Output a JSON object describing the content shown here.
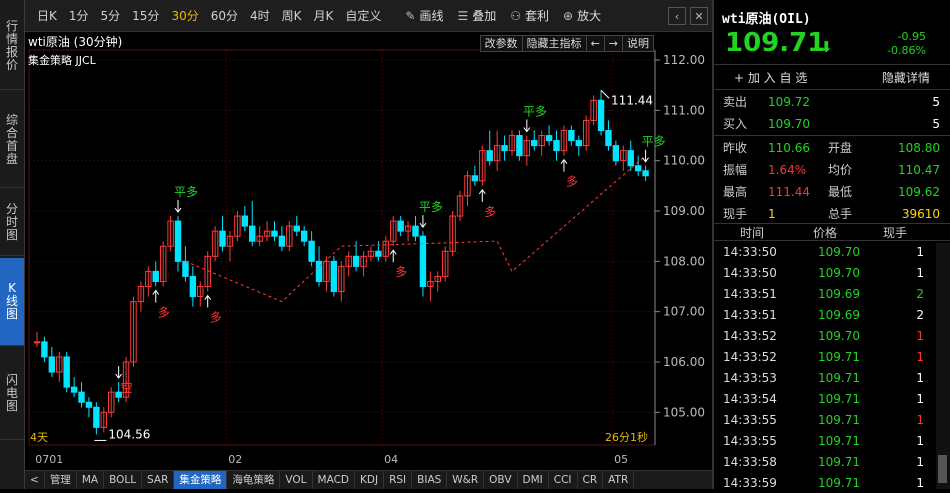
{
  "sidebar": [
    {
      "label": "行情报价",
      "active": false
    },
    {
      "label": "综合首盘",
      "active": false
    },
    {
      "label": "分时图",
      "active": false
    },
    {
      "label": "K线图",
      "active": true
    },
    {
      "label": "闪电图",
      "active": false
    }
  ],
  "toolbar": {
    "periods": [
      "日K",
      "1分",
      "5分",
      "15分",
      "30分",
      "60分",
      "4时",
      "周K",
      "月K",
      "自定义"
    ],
    "active_period": "30分",
    "tools": [
      {
        "icon": "pencil-icon",
        "glyph": "✎",
        "label": "画线"
      },
      {
        "icon": "stack-icon",
        "glyph": "☰",
        "label": "叠加"
      },
      {
        "icon": "arbitrage-icon",
        "glyph": "⚇",
        "label": "套利"
      },
      {
        "icon": "zoom-in-icon",
        "glyph": "⊕",
        "label": "放大"
      }
    ],
    "nav_prev": "‹",
    "nav_close": "✕"
  },
  "chart": {
    "title": "wti原油 (30分钟)",
    "strategy_label": "集金策略 JJCL",
    "buttons": [
      "改参数",
      "隐藏主指标",
      "←",
      "→",
      "说明"
    ],
    "bottom_left": "4天",
    "bottom_right": "26分1秒",
    "max_label": "111.44",
    "min_label": "104.56",
    "signals": {
      "long": "多",
      "flat": "平多",
      "short": "空"
    },
    "scroll_left": "<"
  },
  "chart_data": {
    "type": "candlestick",
    "y_ticks": [
      112.0,
      111.0,
      110.0,
      109.0,
      108.0,
      107.0,
      106.0,
      105.0
    ],
    "ylim": [
      104.35,
      112.2
    ],
    "x_ticks": [
      "0701",
      "02",
      "04",
      "05"
    ],
    "signals": [
      {
        "type": "short",
        "index": 11
      },
      {
        "type": "long",
        "index": 16
      },
      {
        "type": "flat",
        "index": 19
      },
      {
        "type": "long",
        "index": 23
      },
      {
        "type": "long",
        "index": 48
      },
      {
        "type": "flat",
        "index": 52
      },
      {
        "type": "long",
        "index": 60
      },
      {
        "type": "flat",
        "index": 66
      },
      {
        "type": "long",
        "index": 71
      },
      {
        "type": "flat",
        "index": 101
      }
    ],
    "candles": [
      [
        106.4,
        106.6,
        106.3,
        106.4
      ],
      [
        106.4,
        106.5,
        106.0,
        106.1
      ],
      [
        106.1,
        106.3,
        105.7,
        105.8
      ],
      [
        105.8,
        106.2,
        105.6,
        106.1
      ],
      [
        106.1,
        106.2,
        105.4,
        105.5
      ],
      [
        105.5,
        105.7,
        105.3,
        105.4
      ],
      [
        105.4,
        105.6,
        105.1,
        105.2
      ],
      [
        105.2,
        105.3,
        104.9,
        105.1
      ],
      [
        105.1,
        105.2,
        104.56,
        104.7
      ],
      [
        104.7,
        105.1,
        104.6,
        105.0
      ],
      [
        105.0,
        105.5,
        104.9,
        105.4
      ],
      [
        105.4,
        105.6,
        105.2,
        105.3
      ],
      [
        105.3,
        106.1,
        105.2,
        106.0
      ],
      [
        106.0,
        107.3,
        105.9,
        107.2
      ],
      [
        107.2,
        107.6,
        107.0,
        107.5
      ],
      [
        107.5,
        107.9,
        107.3,
        107.8
      ],
      [
        107.8,
        108.0,
        107.5,
        107.6
      ],
      [
        107.6,
        108.4,
        107.5,
        108.3
      ],
      [
        108.3,
        108.9,
        108.2,
        108.8
      ],
      [
        108.8,
        108.9,
        107.8,
        108.0
      ],
      [
        108.0,
        108.3,
        107.6,
        107.7
      ],
      [
        107.7,
        107.9,
        107.1,
        107.3
      ],
      [
        107.3,
        107.6,
        107.1,
        107.5
      ],
      [
        107.5,
        108.2,
        107.4,
        108.1
      ],
      [
        108.1,
        108.7,
        108.0,
        108.6
      ],
      [
        108.6,
        108.9,
        108.2,
        108.3
      ],
      [
        108.3,
        108.6,
        108.0,
        108.5
      ],
      [
        108.5,
        109.0,
        108.4,
        108.9
      ],
      [
        108.9,
        109.1,
        108.6,
        108.7
      ],
      [
        108.7,
        109.2,
        108.3,
        108.4
      ],
      [
        108.4,
        108.7,
        108.3,
        108.5
      ],
      [
        108.5,
        108.8,
        108.4,
        108.6
      ],
      [
        108.6,
        108.8,
        108.4,
        108.5
      ],
      [
        108.5,
        108.7,
        108.2,
        108.3
      ],
      [
        108.3,
        108.8,
        108.2,
        108.7
      ],
      [
        108.7,
        108.9,
        108.5,
        108.6
      ],
      [
        108.6,
        108.7,
        108.3,
        108.4
      ],
      [
        108.4,
        108.6,
        107.9,
        108.0
      ],
      [
        108.0,
        108.3,
        107.5,
        107.6
      ],
      [
        107.6,
        108.1,
        107.4,
        108.0
      ],
      [
        108.0,
        108.1,
        107.3,
        107.4
      ],
      [
        107.4,
        108.0,
        107.2,
        107.9
      ],
      [
        107.9,
        108.2,
        107.7,
        108.1
      ],
      [
        108.1,
        108.4,
        107.8,
        107.9
      ],
      [
        107.9,
        108.2,
        107.7,
        108.1
      ],
      [
        108.1,
        108.3,
        108.0,
        108.2
      ],
      [
        108.2,
        108.4,
        108.0,
        108.1
      ],
      [
        108.1,
        108.5,
        108.0,
        108.4
      ],
      [
        108.4,
        108.9,
        108.3,
        108.8
      ],
      [
        108.8,
        108.9,
        108.5,
        108.6
      ],
      [
        108.6,
        108.8,
        108.4,
        108.7
      ],
      [
        108.7,
        108.9,
        108.4,
        108.5
      ],
      [
        108.5,
        108.6,
        107.3,
        107.5
      ],
      [
        107.5,
        107.8,
        107.2,
        107.6
      ],
      [
        107.6,
        107.8,
        107.4,
        107.7
      ],
      [
        107.7,
        108.3,
        107.6,
        108.2
      ],
      [
        108.2,
        109.0,
        108.1,
        108.9
      ],
      [
        108.9,
        109.4,
        108.8,
        109.3
      ],
      [
        109.3,
        109.8,
        109.1,
        109.7
      ],
      [
        109.7,
        109.9,
        109.5,
        109.6
      ],
      [
        109.6,
        110.3,
        109.5,
        110.2
      ],
      [
        110.2,
        110.6,
        109.9,
        110.0
      ],
      [
        110.0,
        110.6,
        109.8,
        110.3
      ],
      [
        110.3,
        110.5,
        110.0,
        110.2
      ],
      [
        110.2,
        110.6,
        110.1,
        110.5
      ],
      [
        110.5,
        110.6,
        110.0,
        110.1
      ],
      [
        110.1,
        110.5,
        109.9,
        110.4
      ],
      [
        110.4,
        110.6,
        110.2,
        110.3
      ],
      [
        110.3,
        110.6,
        110.1,
        110.5
      ],
      [
        110.5,
        110.7,
        110.3,
        110.4
      ],
      [
        110.4,
        110.6,
        110.0,
        110.2
      ],
      [
        110.2,
        110.7,
        110.1,
        110.6
      ],
      [
        110.6,
        110.7,
        110.3,
        110.4
      ],
      [
        110.4,
        110.5,
        110.1,
        110.3
      ],
      [
        110.3,
        110.9,
        110.2,
        110.8
      ],
      [
        110.8,
        111.3,
        110.7,
        111.2
      ],
      [
        111.2,
        111.4,
        110.5,
        110.6
      ],
      [
        110.6,
        110.8,
        110.2,
        110.3
      ],
      [
        110.3,
        110.4,
        109.9,
        110.0
      ],
      [
        110.0,
        110.3,
        109.8,
        110.2
      ],
      [
        110.2,
        110.4,
        109.8,
        109.9
      ],
      [
        109.9,
        110.1,
        109.7,
        109.8
      ],
      [
        109.8,
        109.9,
        109.6,
        109.7
      ]
    ]
  },
  "panel": {
    "symbol": "wti原油(OIL)",
    "price": "109.71",
    "change": "-0.95",
    "change_pct": "-0.86%",
    "add_watch": "+ 加 入 自 选",
    "hide_detail": "隐藏详情",
    "ask": {
      "label": "卖出",
      "price": "109.72",
      "qty": "5"
    },
    "bid": {
      "label": "买入",
      "price": "109.70",
      "qty": "5"
    },
    "stats": [
      {
        "l1": "昨收",
        "v1": "110.66",
        "c1": "#22d322",
        "l2": "开盘",
        "v2": "108.80",
        "c2": "#22d322"
      },
      {
        "l1": "振幅",
        "v1": "1.64%",
        "c1": "#ff3333",
        "l2": "均价",
        "v2": "110.47",
        "c2": "#22d322"
      },
      {
        "l1": "最高",
        "v1": "111.44",
        "c1": "#ff3333",
        "l2": "最低",
        "v2": "109.62",
        "c2": "#22d322"
      },
      {
        "l1": "现手",
        "v1": "1",
        "c1": "#ffd700",
        "l2": "总手",
        "v2": "39610",
        "c2": "#ffd700"
      }
    ],
    "tick_headers": [
      "时间",
      "价格",
      "现手"
    ],
    "ticks": [
      {
        "time": "14:33:50",
        "price": "109.70",
        "qty": "1",
        "qc": "#ffffff"
      },
      {
        "time": "14:33:50",
        "price": "109.70",
        "qty": "1",
        "qc": "#ffffff"
      },
      {
        "time": "14:33:51",
        "price": "109.69",
        "qty": "2",
        "qc": "#22d322"
      },
      {
        "time": "14:33:51",
        "price": "109.69",
        "qty": "2",
        "qc": "#ffffff"
      },
      {
        "time": "14:33:52",
        "price": "109.70",
        "qty": "1",
        "qc": "#ff3333"
      },
      {
        "time": "14:33:52",
        "price": "109.71",
        "qty": "1",
        "qc": "#ff3333"
      },
      {
        "time": "14:33:53",
        "price": "109.71",
        "qty": "1",
        "qc": "#ffffff"
      },
      {
        "time": "14:33:54",
        "price": "109.71",
        "qty": "1",
        "qc": "#ffffff"
      },
      {
        "time": "14:33:55",
        "price": "109.71",
        "qty": "1",
        "qc": "#ff3333"
      },
      {
        "time": "14:33:55",
        "price": "109.71",
        "qty": "1",
        "qc": "#ffffff"
      },
      {
        "time": "14:33:58",
        "price": "109.71",
        "qty": "1",
        "qc": "#ffffff"
      },
      {
        "time": "14:33:59",
        "price": "109.71",
        "qty": "1",
        "qc": "#ffffff"
      }
    ]
  },
  "bottom_tabs": [
    "管理",
    "MA",
    "BOLL",
    "SAR",
    "集金策略",
    "海龟策略",
    "VOL",
    "MACD",
    "KDJ",
    "RSI",
    "BIAS",
    "W&R",
    "OBV",
    "DMI",
    "CCI",
    "CR",
    "ATR"
  ],
  "bottom_active": "集金策略",
  "colors": {
    "up": "#ff3b3b",
    "down": "#00e5ff",
    "flat": "#00ff00",
    "grid": "#5a1010"
  }
}
